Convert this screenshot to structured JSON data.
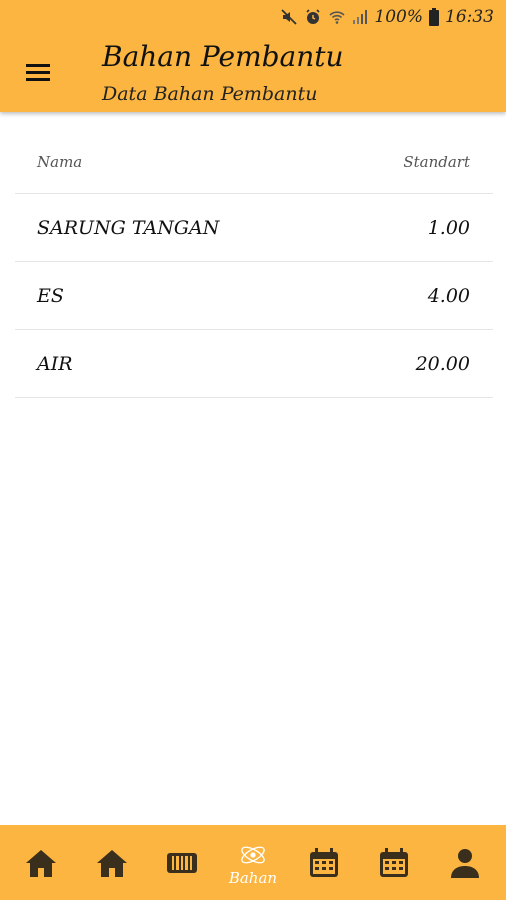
{
  "status_bar": {
    "battery_percent": "100%",
    "time": "16:33",
    "icons": [
      "mute-icon",
      "alarm-icon",
      "wifi-icon",
      "signal-icon",
      "battery-icon"
    ]
  },
  "app_bar": {
    "title": "Bahan Pembantu",
    "subtitle": "Data Bahan Pembantu",
    "menu_icon": "hamburger-menu-icon"
  },
  "table": {
    "headers": {
      "name": "Nama",
      "standard": "Standart"
    },
    "rows": [
      {
        "name": "SARUNG TANGAN",
        "standard": "1.00"
      },
      {
        "name": "ES",
        "standard": "4.00"
      },
      {
        "name": "AIR",
        "standard": "20.00"
      }
    ]
  },
  "bottom_nav": {
    "items": [
      {
        "icon": "home-icon",
        "label": ""
      },
      {
        "icon": "home-icon",
        "label": ""
      },
      {
        "icon": "barcode-icon",
        "label": ""
      },
      {
        "icon": "chemistry-icon",
        "label": "Bahan",
        "active": true
      },
      {
        "icon": "calendar-icon",
        "label": ""
      },
      {
        "icon": "calendar-icon",
        "label": ""
      },
      {
        "icon": "person-icon",
        "label": ""
      }
    ]
  },
  "colors": {
    "primary": "#fbb540",
    "nav_icon": "#3a2f1c",
    "active_icon": "#ffffff",
    "divider": "#e6e6e6"
  }
}
